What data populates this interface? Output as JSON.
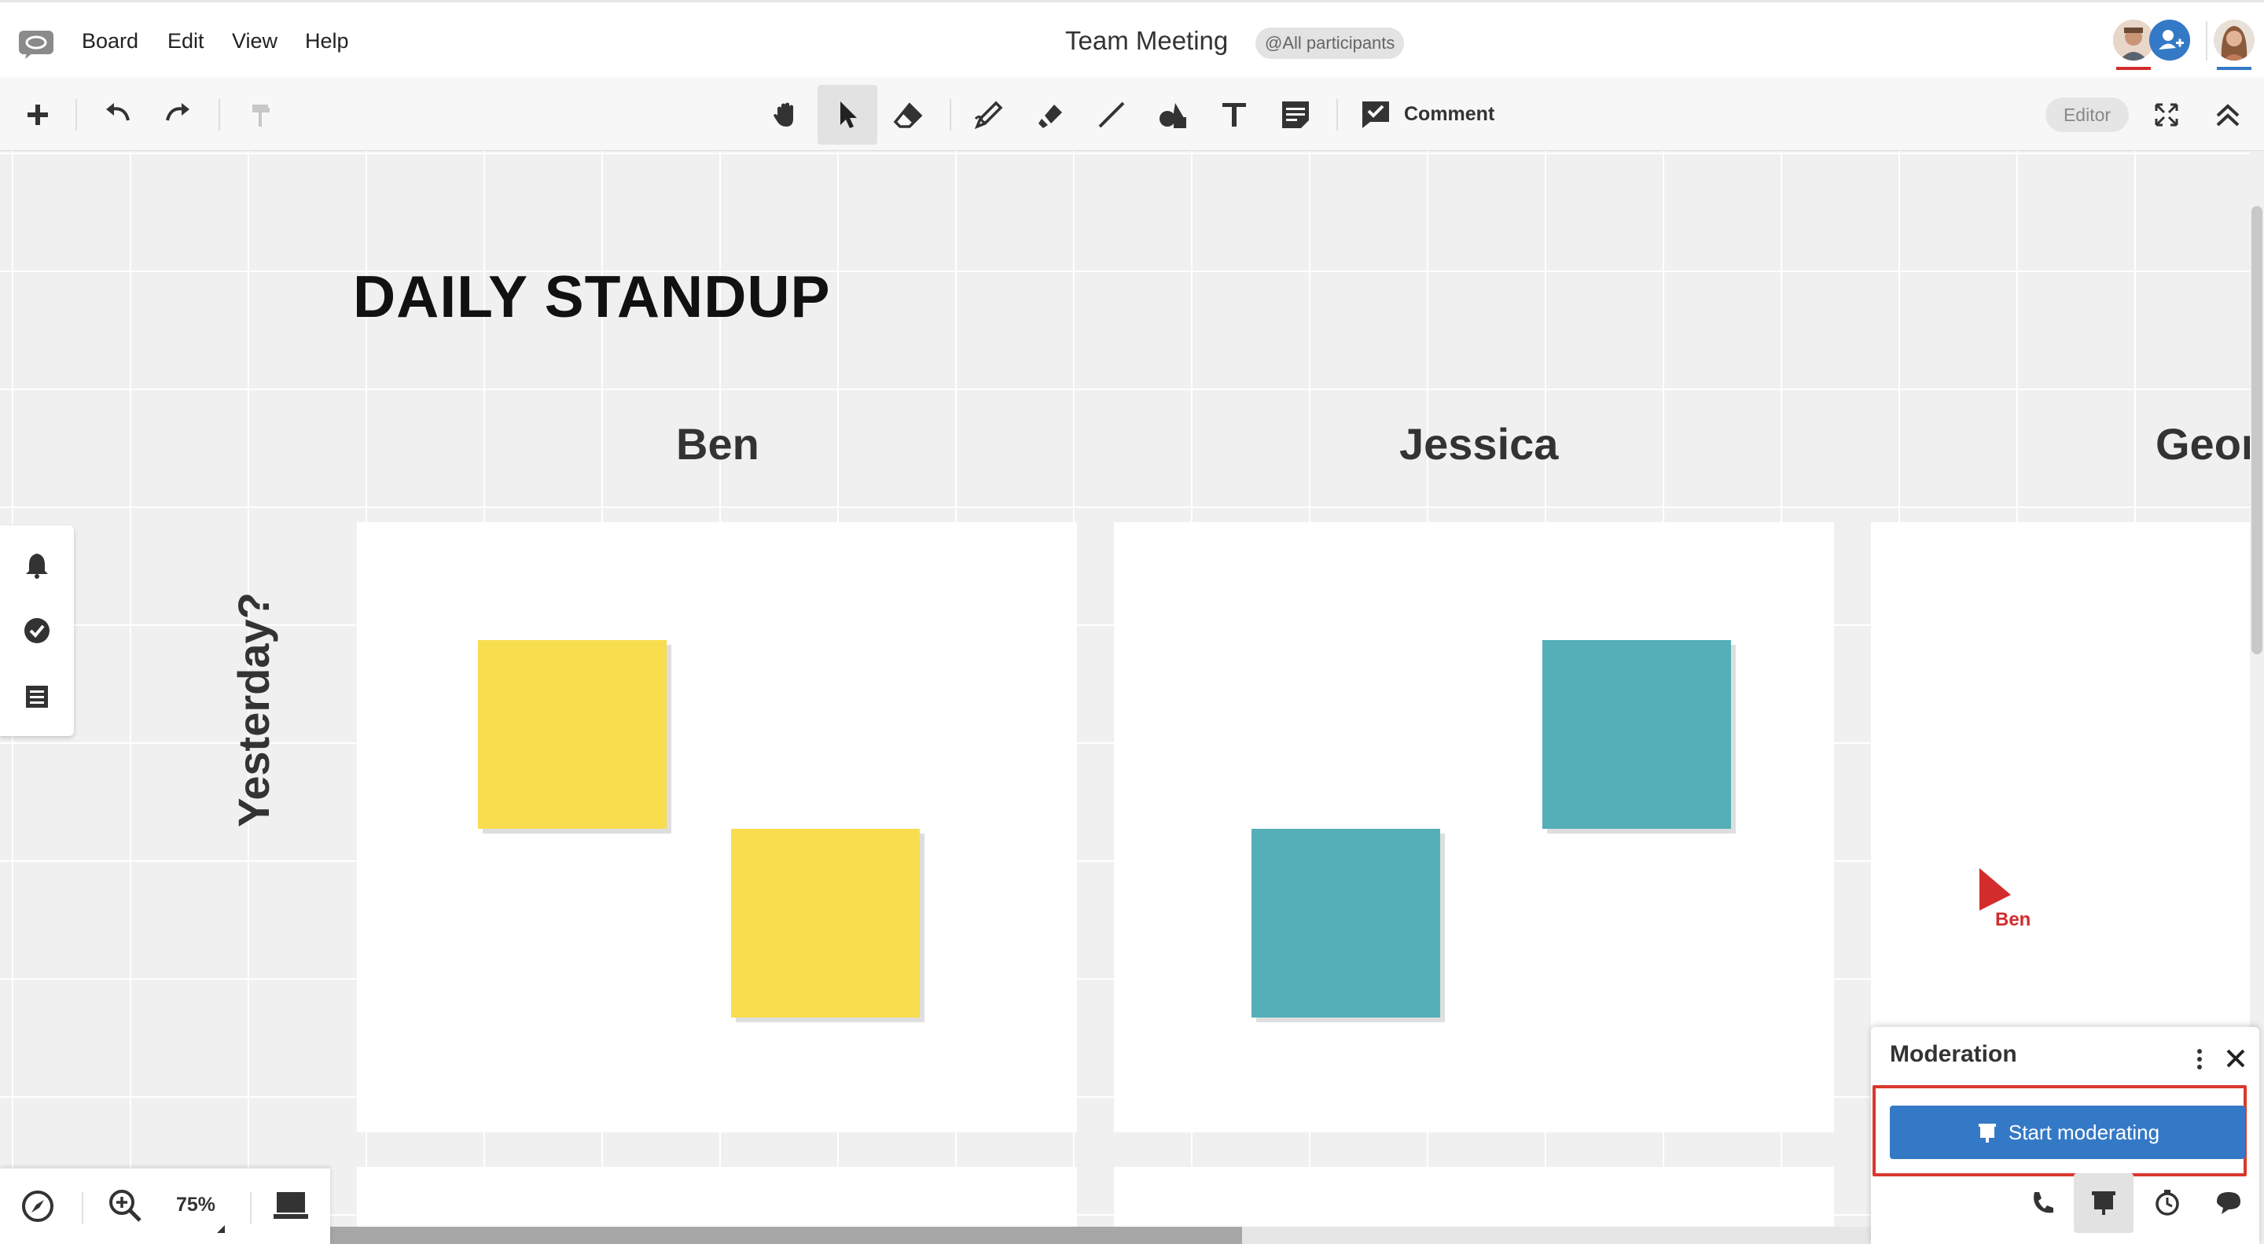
{
  "menubar": {
    "app_logo_icon": "speech-bubble-logo-icon",
    "items": [
      "Board",
      "Edit",
      "View",
      "Help"
    ],
    "board_title": "Team Meeting",
    "participants_badge": "@All participants"
  },
  "toolbar": {
    "left_icons": [
      "plus-icon",
      "undo-icon",
      "redo-icon",
      "format-painter-icon"
    ],
    "center_icons": [
      "hand-icon",
      "pointer-icon",
      "eraser-icon",
      "pen-icon",
      "highlighter-icon",
      "line-icon",
      "shapes-icon",
      "text-icon",
      "sticky-note-icon",
      "comment-icon"
    ],
    "active_tool": "pointer",
    "comment_label": "Comment",
    "editor_badge": "Editor",
    "right_icons": [
      "fit-screen-icon",
      "collapse-icon"
    ]
  },
  "canvas": {
    "board_heading": "DAILY STANDUP",
    "columns": [
      "Ben",
      "Jessica",
      "Geor"
    ],
    "row_label": "Yesterday?",
    "sticky_colors": {
      "yellow": "#f8dd4f",
      "teal": "#54afb8"
    },
    "remote_cursor": {
      "name": "Ben",
      "color": "#d22c2c"
    }
  },
  "left_panel": {
    "icons": [
      "bell-icon",
      "check-circle-icon",
      "list-icon"
    ]
  },
  "bottom_bar": {
    "icons": [
      "compass-icon",
      "zoom-in-icon",
      "presentation-screen-icon"
    ],
    "zoom": "75%"
  },
  "moderation": {
    "title": "Moderation",
    "start_button": "Start moderating",
    "bottom_icons": [
      "phone-icon",
      "presentation-icon",
      "timer-icon",
      "chat-icon"
    ],
    "active_bottom": "presentation-icon"
  },
  "colors": {
    "accent": "#3479c6",
    "highlight": "#d9382e",
    "grid": "#ffffff",
    "canvas_bg": "#f0f0f0"
  }
}
